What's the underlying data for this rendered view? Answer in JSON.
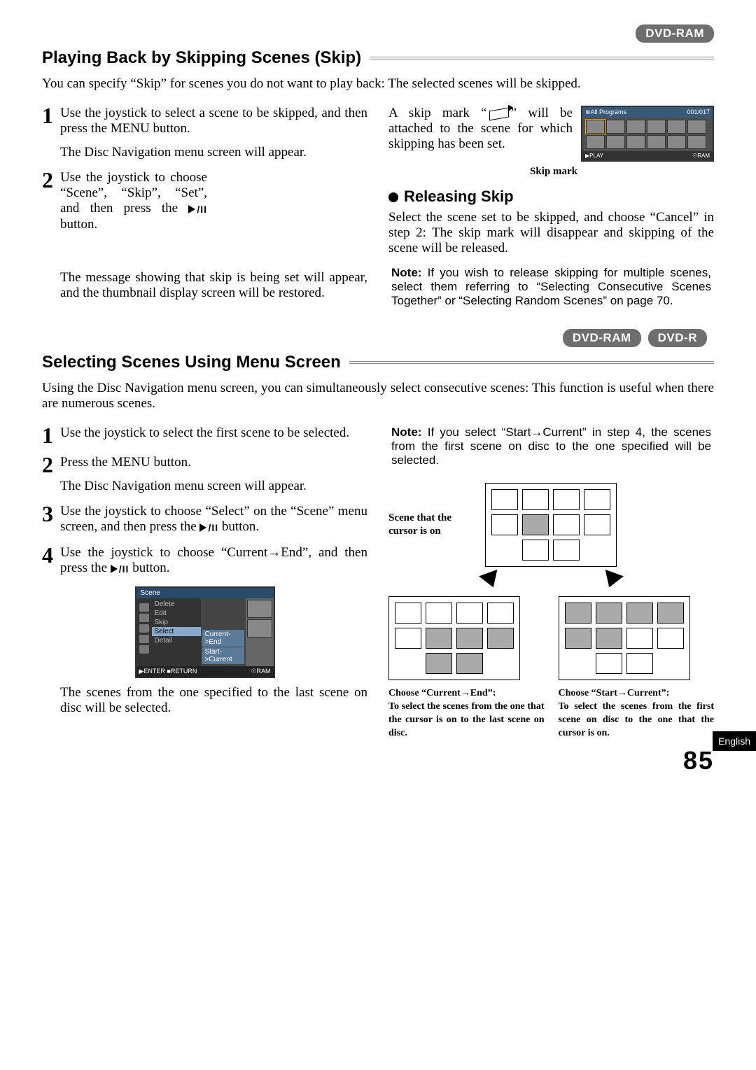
{
  "badges": {
    "dvd_ram": "DVD-RAM",
    "dvd_r": "DVD-R"
  },
  "section1": {
    "heading": "Playing Back by Skipping Scenes (Skip)",
    "intro": "You can specify “Skip” for scenes you do not want to play back: The selected scenes will be skipped.",
    "steps": [
      {
        "num": "1",
        "text": "Use the joystick to select a scene to be skipped, and then press the MENU button.",
        "after": "The Disc Navigation menu screen will appear."
      },
      {
        "num": "2",
        "text_a": "Use the joystick to choose “Scene”, “Skip”, “Set”, and then press the ",
        "text_b": " button.",
        "after": "The message showing that skip is being set will appear, and the thumbnail display screen will be restored."
      }
    ],
    "skip_mark_text_a": "A skip mark “",
    "skip_mark_text_b": "” will be attached to the scene for which skipping has been set.",
    "skip_mark_label": "Skip mark",
    "screen": {
      "title_left": "⊛All Programs",
      "title_right": "001/017",
      "play": "▶PLAY",
      "ram": "☉RAM"
    },
    "releasing": {
      "heading": "Releasing Skip",
      "text": "Select the scene set to be skipped, and choose “Cancel” in step 2: The skip mark will disappear and skipping of the scene will be released.",
      "note_label": "Note:",
      "note_text": "If you wish to release skipping for multiple scenes, select them referring to “Selecting Consecutive Scenes Together” or “Selecting Random Scenes” on page 70."
    }
  },
  "section2": {
    "heading": "Selecting Scenes Using Menu Screen",
    "intro": "Using the Disc Navigation menu screen, you can simultaneously select consecutive scenes: This function is useful when there are numerous scenes.",
    "steps": [
      {
        "num": "1",
        "text": "Use the joystick to select the first scene to be selected."
      },
      {
        "num": "2",
        "text": "Press the MENU button.",
        "after": "The Disc Navigation menu screen will appear."
      },
      {
        "num": "3",
        "text_a": "Use the joystick to choose “Select” on the “Scene” menu screen, and then press the ",
        "text_b": " button."
      },
      {
        "num": "4",
        "text_a": "Use the joystick to choose “Current→End”, and then press the ",
        "text_b": " button."
      }
    ],
    "after_shot": "The scenes from the one specified to the last scene on disc will be selected.",
    "note_label": "Note:",
    "note_text": "If you select “Start→Current” in step 4, the scenes from the first scene on disc to the one specified will be selected.",
    "menu_shot": {
      "title": "Scene",
      "list": [
        "Delete",
        "Edit",
        "Skip",
        "Select",
        "Detail"
      ],
      "sub": [
        "Current->End",
        "Start->Current"
      ],
      "foot_left": "▶ENTER ■RETURN",
      "foot_right": "☉RAM"
    },
    "grid_label_cursor": "Scene that the cursor is on",
    "result_left": {
      "title": "Choose “Current→End”:",
      "text": "To select the scenes from the one that the cursor is on to the last scene on disc."
    },
    "result_right": {
      "title": "Choose “Start→Current”:",
      "text": "To select the scenes from the first scene on disc to the one that the cursor is on."
    }
  },
  "side_tab": "English",
  "page_number": "85"
}
